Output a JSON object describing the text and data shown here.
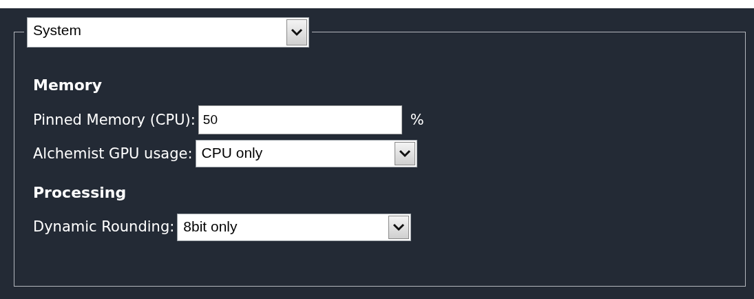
{
  "section_select": {
    "value": "System"
  },
  "groups": [
    {
      "heading": "Memory",
      "fields": [
        {
          "kind": "input",
          "label": "Pinned Memory (CPU):",
          "value": "50",
          "unit": "%"
        },
        {
          "kind": "select",
          "label": "Alchemist GPU usage:",
          "value": "CPU only"
        }
      ]
    },
    {
      "heading": "Processing",
      "fields": [
        {
          "kind": "select",
          "label": "Dynamic Rounding:",
          "value": "8bit only"
        }
      ]
    }
  ]
}
